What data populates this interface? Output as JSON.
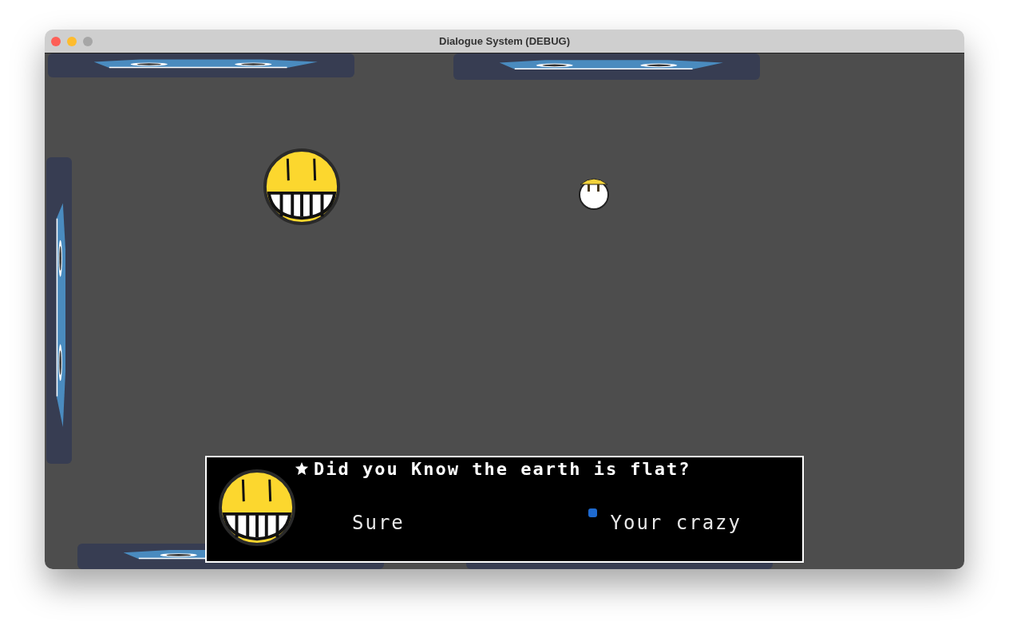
{
  "window": {
    "title": "Dialogue System (DEBUG)"
  },
  "dialogue": {
    "text": "Did you Know the earth is flat?",
    "options": [
      {
        "label": "Sure"
      },
      {
        "label": "Your crazy"
      }
    ]
  }
}
